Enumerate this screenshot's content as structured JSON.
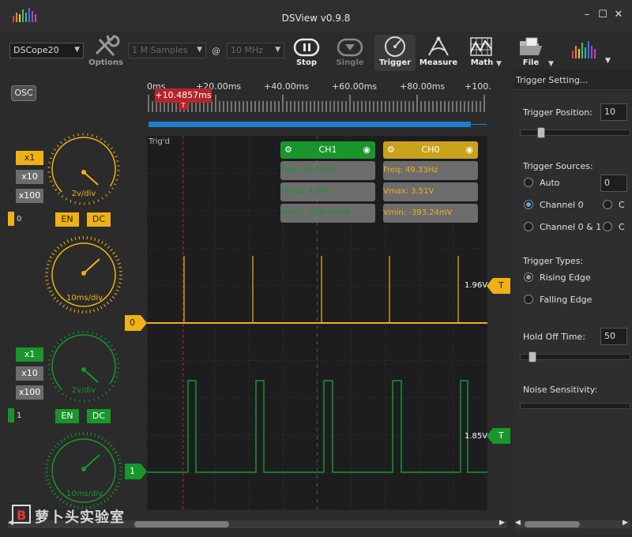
{
  "window": {
    "title": "DSView v0.9.8",
    "minimize": "–",
    "maximize": "☐",
    "close": "✕"
  },
  "toolbar": {
    "device": "DSCope20",
    "options_label": "Options",
    "samples": "1 M Samples",
    "at_sign": "@",
    "rate": "10 MHz",
    "stop_label": "Stop",
    "single_label": "Single",
    "trigger_label": "Trigger",
    "measure_label": "Measure",
    "math_label": "Math",
    "file_label": "File"
  },
  "left": {
    "osc_label": "OSC",
    "ch1": {
      "gains": [
        "x1",
        "x10",
        "x100"
      ],
      "volt_div": "2v/div",
      "index": "0",
      "en": "EN",
      "dc": "DC",
      "time_div": "10ms/div",
      "color": "#f0b115"
    },
    "ch2": {
      "gains": [
        "x1",
        "x10",
        "x100"
      ],
      "volt_div": "2v/div",
      "index": "1",
      "en": "EN",
      "dc": "DC",
      "time_div": "10ms/div",
      "color": "#19962b"
    }
  },
  "ruler": {
    "ticks": [
      "0ms",
      "+20.00ms",
      "+40.00ms",
      "+60.00ms",
      "+80.00ms",
      "+100."
    ],
    "cursor_time": "+10.4857ms",
    "cursor_marker": "T"
  },
  "scope": {
    "status": "Trig'd",
    "ch1_card": {
      "name": "CH1",
      "freq": "Freq: 49.33Hz",
      "vmax": "Vmax: 4.89V",
      "vmin": "Vmin: -268.49mV",
      "color": "#19962b"
    },
    "ch0_card": {
      "name": "CH0",
      "freq": "Freq: 49.33Hz",
      "vmax": "Vmax: 3.51V",
      "vmin": "Vmin: -393.24mV",
      "color": "#c9a21a"
    },
    "ch0_zero_label": "0",
    "ch1_zero_label": "1",
    "ch0_trig_level": "1.96V",
    "ch1_trig_level": "1.85V",
    "trig_marker": "T"
  },
  "right": {
    "header": "Trigger Setting...",
    "position_label": "Trigger Position:",
    "position_value": "10",
    "position_fraction": 0.1,
    "sources_label": "Trigger Sources:",
    "sources": [
      "Auto",
      "Channel 0",
      "Channel 0 & 1"
    ],
    "sources_col2": [
      "C",
      "C"
    ],
    "source_value": "0",
    "selected_source": "Channel 0",
    "types_label": "Trigger Types:",
    "types": [
      "Rising Edge",
      "Falling Edge"
    ],
    "holdoff_label": "Hold Off Time:",
    "holdoff_value": "50",
    "noise_label": "Noise Sensitivity:"
  },
  "watermark": {
    "text": "萝卜头实验室"
  }
}
